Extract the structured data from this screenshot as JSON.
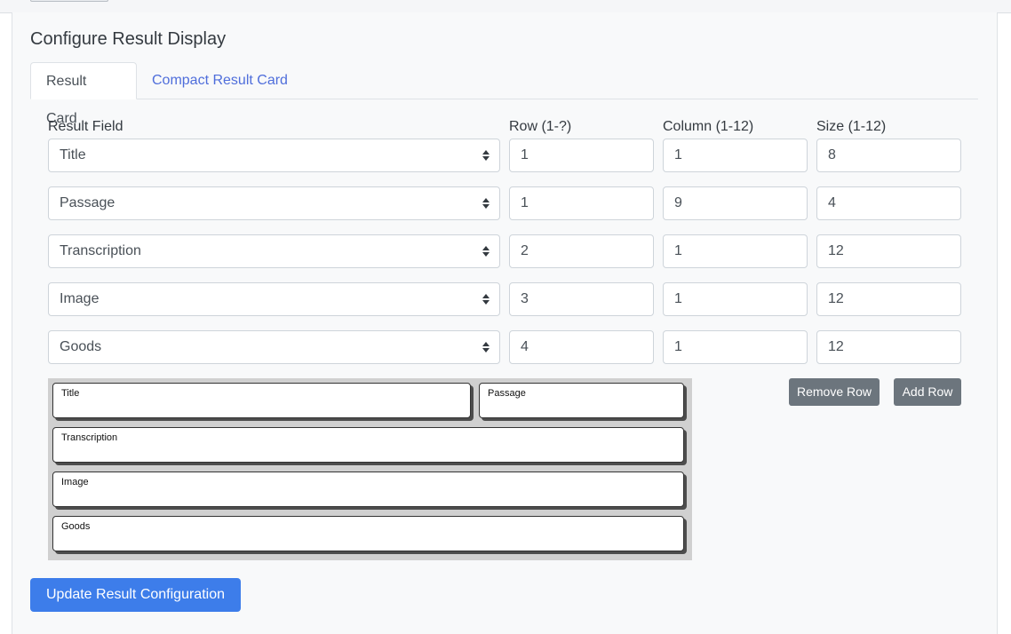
{
  "page": {
    "title": "Configure Result Display",
    "tabs": [
      {
        "label": "Result Card",
        "active": true
      },
      {
        "label": "Compact Result Card",
        "active": false
      }
    ]
  },
  "columns": {
    "field": "Result Field",
    "row": "Row (1-?)",
    "column": "Column (1-12)",
    "size": "Size (1-12)"
  },
  "rows": [
    {
      "field": "Title",
      "row": "1",
      "column": "1",
      "size": "8"
    },
    {
      "field": "Passage",
      "row": "1",
      "column": "9",
      "size": "4"
    },
    {
      "field": "Transcription",
      "row": "2",
      "column": "1",
      "size": "12"
    },
    {
      "field": "Image",
      "row": "3",
      "column": "1",
      "size": "12"
    },
    {
      "field": "Goods",
      "row": "4",
      "column": "1",
      "size": "12"
    }
  ],
  "buttons": {
    "remove_row": "Remove Row",
    "add_row": "Add Row",
    "update": "Update Result Configuration"
  },
  "preview": {
    "cells": [
      "Title",
      "Passage",
      "Transcription",
      "Image",
      "Goods"
    ]
  },
  "colors": {
    "primary": "#3d7dea",
    "secondary": "#6c757d",
    "link": "#4f6edb",
    "panel_bg": "#f8f9fa"
  }
}
